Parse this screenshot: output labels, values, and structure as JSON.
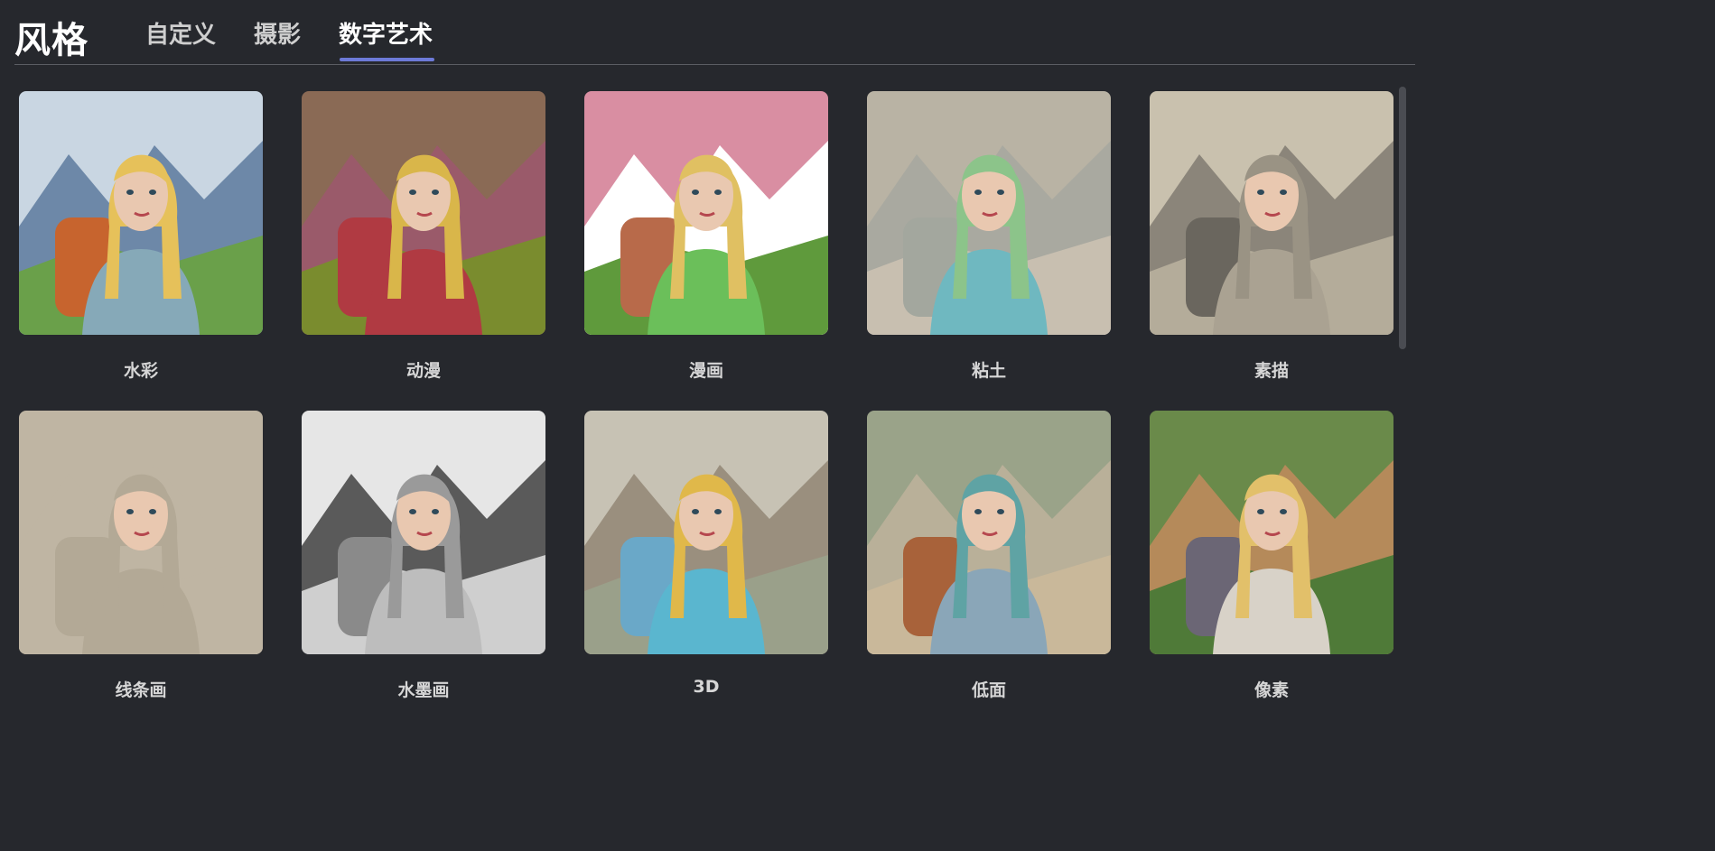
{
  "header": {
    "title": "风格",
    "tabs": [
      {
        "label": "自定义",
        "active": false
      },
      {
        "label": "摄影",
        "active": false
      },
      {
        "label": "数字艺术",
        "active": true
      }
    ]
  },
  "styles": [
    {
      "label": "水彩",
      "sky": "#c9d6e2",
      "mountain": "#6d88a8",
      "ground": "#6aa04a",
      "hair": "#e6c15a",
      "jacket": "#86a9b8",
      "bag": "#c7642e"
    },
    {
      "label": "动漫",
      "sky": "#8a6a55",
      "mountain": "#9a5a6a",
      "ground": "#7a8c2e",
      "hair": "#d9b64a",
      "jacket": "#b03a42",
      "bag": "#b03a42"
    },
    {
      "label": "漫画",
      "sky": "#d98ea2",
      "mountain": "#ffffff",
      "ground": "#5f9a3c",
      "hair": "#e0c062",
      "jacket": "#6bbf5a",
      "bag": "#b86a4a"
    },
    {
      "label": "粘土",
      "sky": "#b9b3a4",
      "mountain": "#a9a9a0",
      "ground": "#c8bfb0",
      "hair": "#8cc48a",
      "jacket": "#6fb8c0",
      "bag": "#a3a79e"
    },
    {
      "label": "素描",
      "sky": "#c9c1ae",
      "mountain": "#8b857a",
      "ground": "#b4ac9a",
      "hair": "#9a9384",
      "jacket": "#aaa292",
      "bag": "#6a665e"
    },
    {
      "label": "线条画",
      "sky": "#bfb5a3",
      "mountain": "#bfb5a3",
      "ground": "#bfb5a3",
      "hair": "#b3a996",
      "jacket": "#b3a996",
      "bag": "#b3a996"
    },
    {
      "label": "水墨画",
      "sky": "#e6e6e6",
      "mountain": "#5a5a5a",
      "ground": "#cfcfcf",
      "hair": "#9a9a9a",
      "jacket": "#bdbdbd",
      "bag": "#8a8a8a"
    },
    {
      "label": "3D",
      "sky": "#c7c2b4",
      "mountain": "#9a8f7e",
      "ground": "#9aa08a",
      "hair": "#e0b84a",
      "jacket": "#5ab6cf",
      "bag": "#6aa8c8"
    },
    {
      "label": "低面",
      "sky": "#9aa389",
      "mountain": "#b9b099",
      "ground": "#c9b89a",
      "hair": "#5fa3a4",
      "jacket": "#8aa6b8",
      "bag": "#a8623a"
    },
    {
      "label": "像素",
      "sky": "#6a8a4a",
      "mountain": "#b58a5a",
      "ground": "#4f7a38",
      "hair": "#e2c06a",
      "jacket": "#d8d2c8",
      "bag": "#6b6675"
    }
  ]
}
